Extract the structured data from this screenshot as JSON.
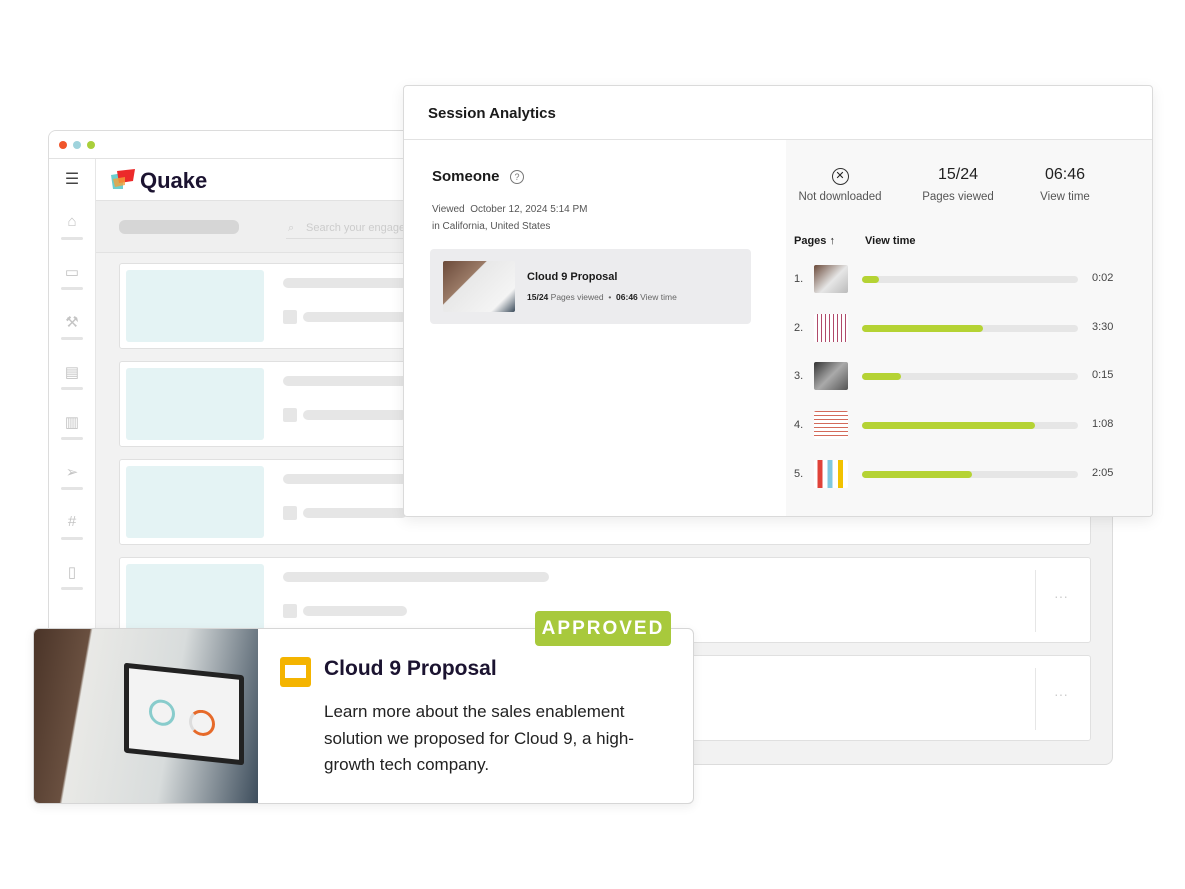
{
  "app": {
    "logo_text": "Quake",
    "search_placeholder": "Search your engagements",
    "row_more": "···"
  },
  "session": {
    "title": "Session Analytics",
    "viewer": "Someone",
    "viewed_label": "Viewed",
    "viewed_date": "October 12, 2024 5:14 PM",
    "location": "in California, United States",
    "doc": {
      "title": "Cloud 9 Proposal",
      "pages": "15/24",
      "pages_label": "Pages viewed",
      "sep": "•",
      "time": "06:46",
      "time_label": "View time"
    },
    "stats": [
      {
        "icon": "x-circle-icon",
        "value": "",
        "label": "Not downloaded"
      },
      {
        "value": "15/24",
        "label": "Pages viewed"
      },
      {
        "value": "06:46",
        "label": "View time"
      }
    ],
    "table_headers": {
      "pages": "Pages",
      "sort_icon": "↑",
      "view_time": "View time"
    },
    "pages": [
      {
        "num": "1.",
        "time": "0:02",
        "fraction": 0.08
      },
      {
        "num": "2.",
        "time": "3:30",
        "fraction": 0.56
      },
      {
        "num": "3.",
        "time": "0:15",
        "fraction": 0.18
      },
      {
        "num": "4.",
        "time": "1:08",
        "fraction": 0.8
      },
      {
        "num": "5.",
        "time": "2:05",
        "fraction": 0.51
      }
    ],
    "accent": "#b5d334"
  },
  "card": {
    "badge": "APPROVED",
    "title": "Cloud 9 Proposal",
    "description": "Learn more about the sales enablement solution we proposed for Cloud 9, a high-growth tech company.",
    "icon": "slides-icon",
    "badge_color": "#a8c93c"
  }
}
